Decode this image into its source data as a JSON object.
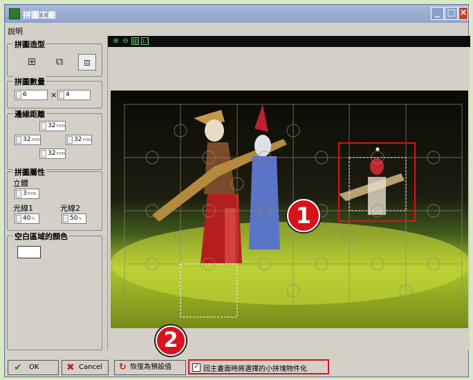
{
  "window": {
    "title": "拼圖工廠",
    "menu": "說明"
  },
  "shape_group": {
    "title": "拼圖造型",
    "options": [
      "grid-plain-icon",
      "grid-jigsaw-icon",
      "grid-jigsaw-alt-icon"
    ],
    "selected_index": 2
  },
  "count_group": {
    "title": "拼圖數量",
    "cols": "6",
    "times": "×",
    "rows": "4"
  },
  "margin_group": {
    "title": "邊緣距離",
    "top": "32",
    "left": "32",
    "right": "32",
    "bottom": "32",
    "unit": "PIXEL"
  },
  "attr_group": {
    "title": "拼圖屬性",
    "depth_label": "立體",
    "depth_value": "3",
    "depth_unit": "PIXEL",
    "light1_label": "光線1",
    "light1_value": "40",
    "light2_label": "光線2",
    "light2_value": "50",
    "light_unit": "%"
  },
  "blank_color_group": {
    "title": "空白區域的顏色",
    "color": "#ffffff"
  },
  "toolbar_icons": [
    "zoom-in-icon",
    "zoom-out-icon",
    "fit-icon",
    "actual-size-icon"
  ],
  "buttons": {
    "ok": "OK",
    "cancel": "Cancel",
    "restore": "恢復為預設值",
    "checkbox_label": "回主畫面時將選擇的小拼塊物件化",
    "checkbox_checked": true
  },
  "annotations": {
    "one": "1",
    "two": "2"
  },
  "colors": {
    "title_bar": "#9aaed0",
    "annotation_red": "#d8131c",
    "zoom_bar": "#0d0d0d"
  }
}
